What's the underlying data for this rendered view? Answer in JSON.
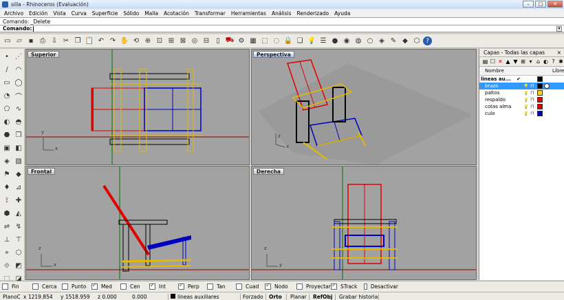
{
  "window": {
    "title": "silla - Rhinoceros (Evaluación)",
    "buttons": [
      "–",
      "□",
      "✕"
    ]
  },
  "menu": [
    "Archivo",
    "Edición",
    "Vista",
    "Curva",
    "Superficie",
    "Sólido",
    "Malla",
    "Acotación",
    "Transformar",
    "Herramientas",
    "Análisis",
    "Renderizado",
    "Ayuda"
  ],
  "command": {
    "history": "Comando: _Delete",
    "prompt_label": "Comando:",
    "value": ""
  },
  "toolbar_icons": [
    "new-file-icon",
    "open-icon",
    "save-icon",
    "print-icon",
    "import-icon",
    "cut-icon",
    "copy-icon",
    "paste-icon",
    "undo-icon",
    "redo-icon",
    "pan-icon",
    "rotate-view-icon",
    "zoom-icon",
    "zoom-window-icon",
    "zoom-extents-icon",
    "zoom-all-icon",
    "zoom-selected-icon",
    "four-views-icon",
    "rectangle-icon",
    "car-icon",
    "options-icon",
    "grid-icon",
    "select-icon",
    "hide-icon",
    "lock-icon",
    "layer-icon",
    "light-icon",
    "properties-icon",
    "shade-icon",
    "render-icon",
    "rendered-sphere-icon",
    "ghosted-sphere-icon",
    "material-icon",
    "paint-icon",
    "analyze-icon",
    "mesh-icon",
    "help-icon"
  ],
  "viewports": {
    "top": {
      "label": "Superior"
    },
    "perspective": {
      "label": "Perspectiva"
    },
    "front": {
      "label": "Frontal"
    },
    "right": {
      "label": "Derecha"
    }
  },
  "axes": {
    "x": "x",
    "y": "y",
    "z": "z"
  },
  "layers": {
    "title": "Capas - Todas las capas",
    "close": "×",
    "tools": [
      "▤",
      "☐",
      "✕",
      "▲",
      "▼",
      "⊞",
      "▾",
      "⌂",
      "◐",
      "?",
      "✱"
    ],
    "col_name": "Nombre",
    "col_extra": "Librer",
    "parent": {
      "name": "lineas au...",
      "check": "✔",
      "color": "#000000"
    },
    "items": [
      {
        "name": "brazo",
        "color": "#000000",
        "selected": true
      },
      {
        "name": "paltos",
        "color": "#ffd700",
        "selected": false
      },
      {
        "name": "respaldo",
        "color": "#e00000",
        "selected": false
      },
      {
        "name": "cotas alma",
        "color": "#e00000",
        "selected": false
      },
      {
        "name": "culo",
        "color": "#0000c0",
        "selected": false
      }
    ]
  },
  "osnaps": [
    {
      "label": "Fin",
      "on": false
    },
    {
      "label": "Cerca",
      "on": false
    },
    {
      "label": "Punto",
      "on": false
    },
    {
      "label": "Med",
      "on": true
    },
    {
      "label": "Cen",
      "on": false
    },
    {
      "label": "Int",
      "on": true
    },
    {
      "label": "Perp",
      "on": true
    },
    {
      "label": "Tan",
      "on": false
    },
    {
      "label": "Cuad",
      "on": false
    },
    {
      "label": "Nodo",
      "on": true
    },
    {
      "label": "Proyectar",
      "on": false
    },
    {
      "label": "STrack",
      "on": true
    },
    {
      "label": "Desactivar",
      "on": false
    }
  ],
  "status": {
    "plane": "PlanoC",
    "x": "x 1219.854",
    "y": "y 1518.959",
    "z": "z 0.000",
    "dist": "0.000",
    "layer": "lineas auxiliares",
    "forzado": "Forzado",
    "orto": "Orto",
    "planar": "Planar",
    "refobj": "RefObj",
    "history": "Grabar historial"
  }
}
